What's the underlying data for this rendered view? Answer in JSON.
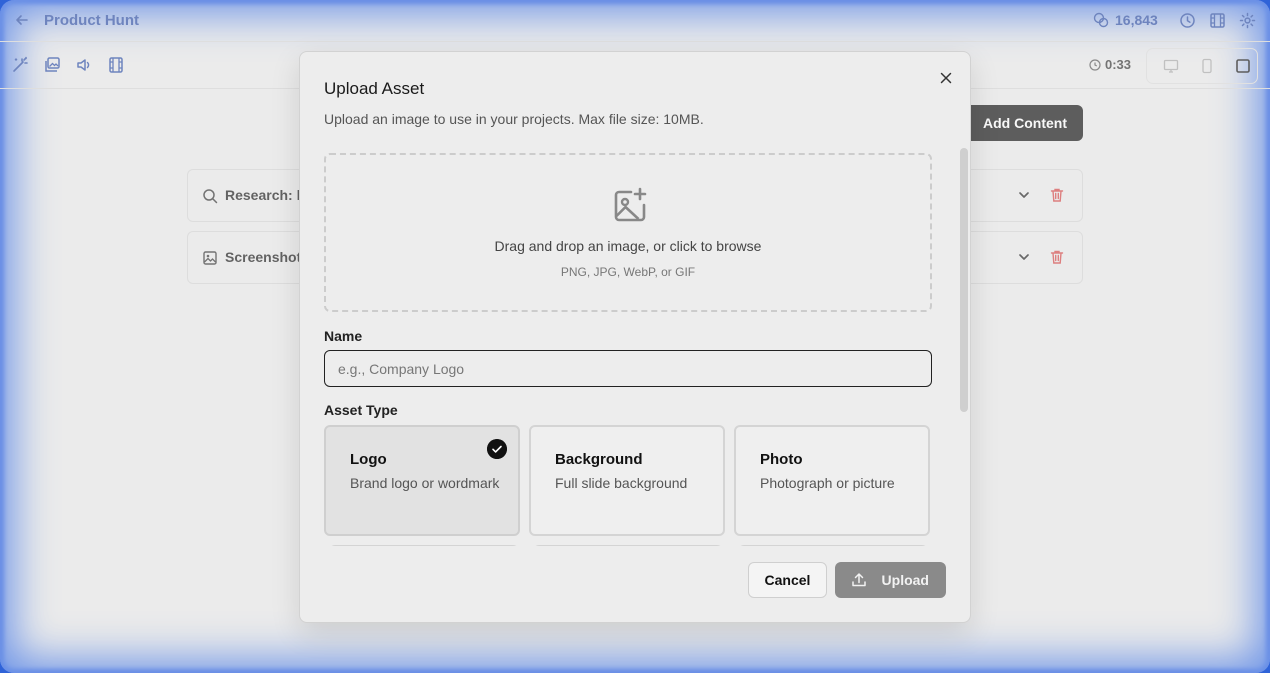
{
  "app": {
    "title": "Product Hunt",
    "credits": "16,843"
  },
  "toolbar": {
    "timer": "0:33"
  },
  "main": {
    "add_content_label": "Add Content",
    "rows": [
      {
        "label": "Research: h"
      },
      {
        "label": "Screenshot"
      }
    ]
  },
  "modal": {
    "title": "Upload Asset",
    "description": "Upload an image to use in your projects. Max file size: 10MB.",
    "dropzone": {
      "main_text": "Drag and drop an image, or click to browse",
      "formats": "PNG, JPG, WebP, or GIF"
    },
    "name_label": "Name",
    "name_placeholder": "e.g., Company Logo",
    "name_value": "",
    "asset_type_label": "Asset Type",
    "asset_types": [
      {
        "title": "Logo",
        "desc": "Brand logo or wordmark",
        "selected": true
      },
      {
        "title": "Background",
        "desc": "Full slide background",
        "selected": false
      },
      {
        "title": "Photo",
        "desc": "Photograph or picture",
        "selected": false
      }
    ],
    "cancel_label": "Cancel",
    "upload_label": "Upload"
  },
  "colors": {
    "accent": "#2b4ea6",
    "frame_glow": "#2f63d8",
    "danger": "#d64545"
  }
}
